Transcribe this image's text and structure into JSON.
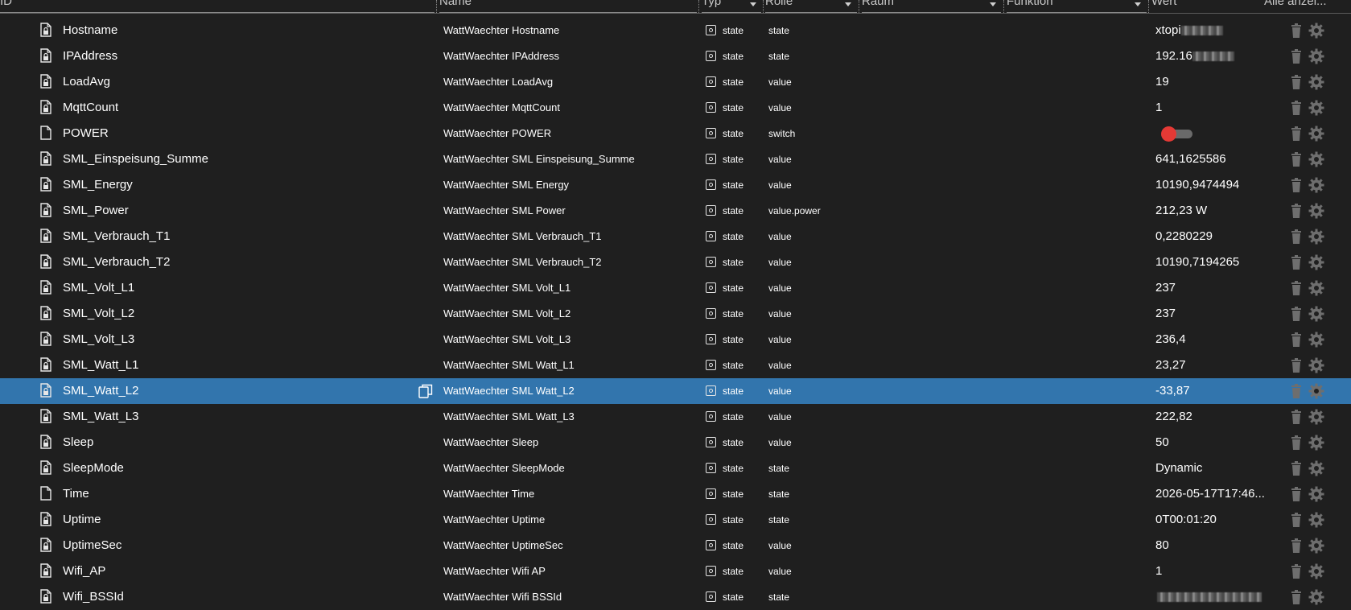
{
  "header": {
    "col_id": "ID",
    "col_name": "Name",
    "col_type": "Typ",
    "col_role": "Rolle",
    "col_room": "Raum",
    "col_function": "Funktion",
    "col_value": "Wert",
    "col_all": "Alle anzei..."
  },
  "rows": [
    {
      "id": "Hostname",
      "name": "WattWaechter Hostname",
      "type": "state",
      "role": "state",
      "value": "xtopi",
      "blurred": true,
      "icon": "file-lock-icon"
    },
    {
      "id": "IPAddress",
      "name": "WattWaechter IPAddress",
      "type": "state",
      "role": "state",
      "value": "192.16",
      "blurred": true,
      "icon": "file-lock-icon"
    },
    {
      "id": "LoadAvg",
      "name": "WattWaechter LoadAvg",
      "type": "state",
      "role": "value",
      "value": "19",
      "icon": "file-lock-icon"
    },
    {
      "id": "MqttCount",
      "name": "WattWaechter MqttCount",
      "type": "state",
      "role": "value",
      "value": "1",
      "icon": "file-lock-icon"
    },
    {
      "id": "POWER",
      "name": "WattWaechter POWER",
      "type": "state",
      "role": "switch",
      "value": "",
      "toggle": true,
      "toggle_on": false,
      "icon": "file-icon"
    },
    {
      "id": "SML_Einspeisung_Summe",
      "name": "WattWaechter SML Einspeisung_Summe",
      "type": "state",
      "role": "value",
      "value": "641,1625586",
      "icon": "file-lock-icon"
    },
    {
      "id": "SML_Energy",
      "name": "WattWaechter SML Energy",
      "type": "state",
      "role": "value",
      "value": "10190,9474494",
      "icon": "file-lock-icon"
    },
    {
      "id": "SML_Power",
      "name": "WattWaechter SML Power",
      "type": "state",
      "role": "value.power",
      "value": "212,23 W",
      "icon": "file-lock-icon"
    },
    {
      "id": "SML_Verbrauch_T1",
      "name": "WattWaechter SML Verbrauch_T1",
      "type": "state",
      "role": "value",
      "value": "0,2280229",
      "icon": "file-lock-icon"
    },
    {
      "id": "SML_Verbrauch_T2",
      "name": "WattWaechter SML Verbrauch_T2",
      "type": "state",
      "role": "value",
      "value": "10190,7194265",
      "icon": "file-lock-icon"
    },
    {
      "id": "SML_Volt_L1",
      "name": "WattWaechter SML Volt_L1",
      "type": "state",
      "role": "value",
      "value": "237",
      "icon": "file-lock-icon"
    },
    {
      "id": "SML_Volt_L2",
      "name": "WattWaechter SML Volt_L2",
      "type": "state",
      "role": "value",
      "value": "237",
      "icon": "file-lock-icon"
    },
    {
      "id": "SML_Volt_L3",
      "name": "WattWaechter SML Volt_L3",
      "type": "state",
      "role": "value",
      "value": "236,4",
      "icon": "file-lock-icon"
    },
    {
      "id": "SML_Watt_L1",
      "name": "WattWaechter SML Watt_L1",
      "type": "state",
      "role": "value",
      "value": "23,27",
      "icon": "file-lock-icon"
    },
    {
      "id": "SML_Watt_L2",
      "name": "WattWaechter SML Watt_L2",
      "type": "state",
      "role": "value",
      "value": "-33,87",
      "selected": true,
      "icon": "file-lock-icon"
    },
    {
      "id": "SML_Watt_L3",
      "name": "WattWaechter SML Watt_L3",
      "type": "state",
      "role": "value",
      "value": "222,82",
      "icon": "file-lock-icon"
    },
    {
      "id": "Sleep",
      "name": "WattWaechter Sleep",
      "type": "state",
      "role": "value",
      "value": "50",
      "icon": "file-lock-icon"
    },
    {
      "id": "SleepMode",
      "name": "WattWaechter SleepMode",
      "type": "state",
      "role": "state",
      "value": "Dynamic",
      "icon": "file-lock-icon"
    },
    {
      "id": "Time",
      "name": "WattWaechter Time",
      "type": "state",
      "role": "state",
      "value": "2026-05-17T17:46...",
      "icon": "file-icon"
    },
    {
      "id": "Uptime",
      "name": "WattWaechter Uptime",
      "type": "state",
      "role": "state",
      "value": "0T00:01:20",
      "icon": "file-lock-icon"
    },
    {
      "id": "UptimeSec",
      "name": "WattWaechter UptimeSec",
      "type": "state",
      "role": "value",
      "value": "80",
      "icon": "file-lock-icon"
    },
    {
      "id": "Wifi_AP",
      "name": "WattWaechter Wifi AP",
      "type": "state",
      "role": "value",
      "value": "1",
      "icon": "file-lock-icon"
    },
    {
      "id": "Wifi_BSSId",
      "name": "WattWaechter Wifi BSSId",
      "type": "state",
      "role": "state",
      "value": "",
      "blurred": true,
      "icon": "file-lock-icon"
    }
  ],
  "colors": {
    "background": "#1f1f1f",
    "selected_row": "#3275ad",
    "toggle_knob_off": "#e53935",
    "icon_grey": "#6e6e6e"
  }
}
